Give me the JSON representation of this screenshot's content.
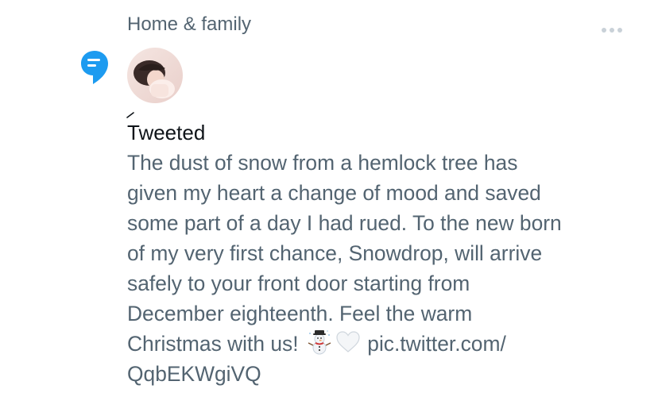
{
  "header": {
    "topic": "Home & family",
    "more_icon": "more-horizontal-icon"
  },
  "context": {
    "topic_icon": "topic-speech-bubble-icon",
    "topic_icon_color": "#1d9bf0"
  },
  "tweet": {
    "label": "Tweeted",
    "lines": [
      "The dust of snow from a hemlock tree has",
      "given my heart a change of mood and saved",
      "some part of a day I had rued. To the new born",
      "of my very first chance, Snowdrop, will arrive",
      "safely to your front door starting from",
      "December eighteenth. Feel the warm",
      "Christmas with us!"
    ],
    "emojis": [
      "snowman-icon",
      "white-heart-icon"
    ],
    "link_part1": "pic.twitter.com/",
    "link_part2": "QqbEKWgiVQ"
  },
  "colors": {
    "secondary_text": "#536471",
    "primary_text": "#0f1419",
    "accent": "#1d9bf0"
  }
}
